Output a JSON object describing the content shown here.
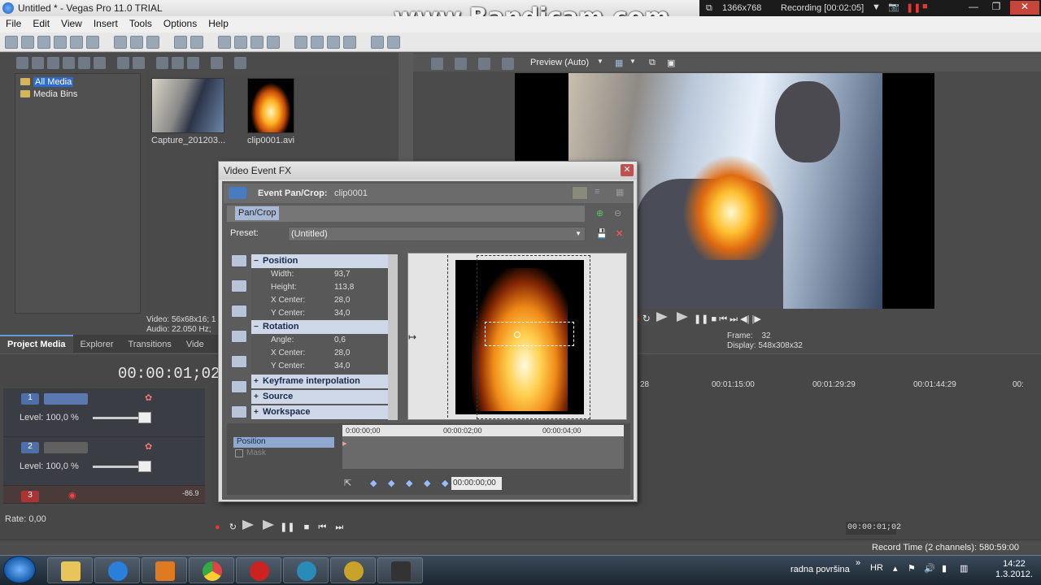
{
  "window": {
    "title": "Untitled * - Vegas Pro 11.0 TRIAL"
  },
  "watermark": "www.Bandicam.com",
  "recorder": {
    "resolution": "1366x768",
    "status": "Recording [00:02:05]"
  },
  "menu": [
    "File",
    "Edit",
    "View",
    "Insert",
    "Tools",
    "Options",
    "Help"
  ],
  "media_tree": {
    "items": [
      "All Media",
      "Media Bins"
    ]
  },
  "media_files": [
    "Capture_201203...",
    "clip0001.avi"
  ],
  "media_info": {
    "line1": "Video: 56x68x16; 1",
    "line2": "Audio: 22.050 Hz;"
  },
  "left_tabs": [
    "Project Media",
    "Explorer",
    "Transitions",
    "Vide"
  ],
  "preview": {
    "mode": "Preview (Auto)",
    "frame_label": "Frame:",
    "frame_value": "32",
    "display_label": "Display:",
    "display_value": "548x308x32"
  },
  "timeline": {
    "timecode": "00:00:01;02",
    "tracks": [
      {
        "num": "1",
        "level_label": "Level: 100,0 %"
      },
      {
        "num": "2",
        "level_label": "Level: 100,0 %"
      },
      {
        "num": "3",
        "level_value": "-86.9"
      }
    ],
    "ruler": [
      "00:01:15:00",
      "00:01:29:29",
      "00:01:44:29",
      "00:"
    ],
    "ruler_prefix": "28",
    "rate": "Rate: 0,00",
    "cursor_time": "00:00:01;02"
  },
  "status": {
    "record_time": "Record Time (2 channels): 580:59:00"
  },
  "fx_dialog": {
    "title": "Video Event FX",
    "header_label": "Event Pan/Crop:",
    "header_clip": "clip0001",
    "chain_tab": "Pan/Crop",
    "preset_label": "Preset:",
    "preset_value": "(Untitled)",
    "position": {
      "label": "Position",
      "width_label": "Width:",
      "width": "93,7",
      "height_label": "Height:",
      "height": "113,8",
      "xcenter_label": "X Center:",
      "xcenter": "28,0",
      "ycenter_label": "Y Center:",
      "ycenter": "34,0"
    },
    "rotation": {
      "label": "Rotation",
      "angle_label": "Angle:",
      "angle": "0,6",
      "xcenter_label": "X Center:",
      "xcenter": "28,0",
      "ycenter_label": "Y Center:",
      "ycenter": "34,0"
    },
    "collapsed": [
      "Keyframe interpolation",
      "Source",
      "Workspace"
    ],
    "kf_tracks": [
      "Position",
      "Mask"
    ],
    "kf_ruler": [
      "0:00:00;00",
      "00:00:02;00",
      "00:00:04;00"
    ],
    "kf_time": "00:00:00;00"
  },
  "taskbar": {
    "desktop_label": "radna površina",
    "lang": "HR",
    "time": "14:22",
    "date": "1.3.2012."
  }
}
